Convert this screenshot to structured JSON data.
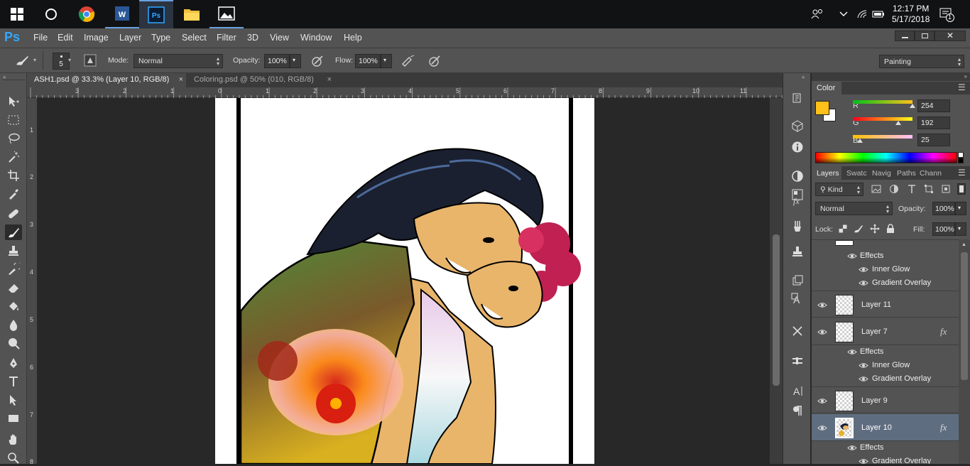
{
  "taskbar": {
    "apps": [
      "start-button",
      "cortana",
      "chrome",
      "word",
      "photoshop",
      "file-explorer",
      "photos"
    ],
    "clock_time": "12:17 PM",
    "clock_date": "5/17/2018",
    "notification_count": "1"
  },
  "app": {
    "logo": "Ps"
  },
  "menu": [
    "File",
    "Edit",
    "Image",
    "Layer",
    "Type",
    "Select",
    "Filter",
    "3D",
    "View",
    "Window",
    "Help"
  ],
  "options": {
    "brush_size": "5",
    "mode_label": "Mode:",
    "mode_value": "Normal",
    "opacity_label": "Opacity:",
    "opacity_value": "100%",
    "flow_label": "Flow:",
    "flow_value": "100%",
    "workspace": "Painting"
  },
  "doc_tabs": [
    {
      "label": "ASH1.psd @ 33.3% (Layer 10, RGB/8)",
      "close": "×"
    },
    {
      "label": "Coloring.psd @ 50% (010, RGB/8)",
      "close": "×"
    }
  ],
  "ruler": {
    "h": [
      "3",
      "2",
      "1",
      "0",
      "1",
      "2",
      "3",
      "4",
      "5",
      "6",
      "7",
      "8",
      "9",
      "10",
      "11"
    ],
    "v": [
      "1",
      "2",
      "3",
      "4",
      "5",
      "6",
      "7",
      "8"
    ]
  },
  "color_panel": {
    "title": "Color",
    "r_label": "R",
    "r_value": "254",
    "g_label": "G",
    "g_value": "192",
    "b_label": "B",
    "b_value": "25",
    "foreground": "#FEC019",
    "background": "#FFFFFF"
  },
  "layers_panel": {
    "tabs": [
      "Layers",
      "Swatc",
      "Navig",
      "Paths",
      "Chann"
    ],
    "filter_kind": "Kind",
    "blend_mode": "Normal",
    "opacity_label": "Opacity:",
    "opacity_value": "100%",
    "lock_label": "Lock:",
    "fill_label": "Fill:",
    "fill_value": "100%",
    "rows": [
      {
        "type": "fx-header",
        "label": "Effects"
      },
      {
        "type": "fx",
        "label": "Inner Glow"
      },
      {
        "type": "fx",
        "label": "Gradient Overlay"
      },
      {
        "type": "layer",
        "label": "Layer 11",
        "has_fx": false
      },
      {
        "type": "layer",
        "label": "Layer 7",
        "has_fx": true
      },
      {
        "type": "fx-header",
        "label": "Effects"
      },
      {
        "type": "fx",
        "label": "Inner Glow"
      },
      {
        "type": "fx",
        "label": "Gradient Overlay"
      },
      {
        "type": "layer",
        "label": "Layer 9",
        "has_fx": false
      },
      {
        "type": "layer",
        "label": "Layer 10",
        "has_fx": true,
        "selected": true
      },
      {
        "type": "fx-header",
        "label": "Effects"
      },
      {
        "type": "fx",
        "label": "Gradient Overlay"
      }
    ],
    "fx_symbol": "fx"
  }
}
